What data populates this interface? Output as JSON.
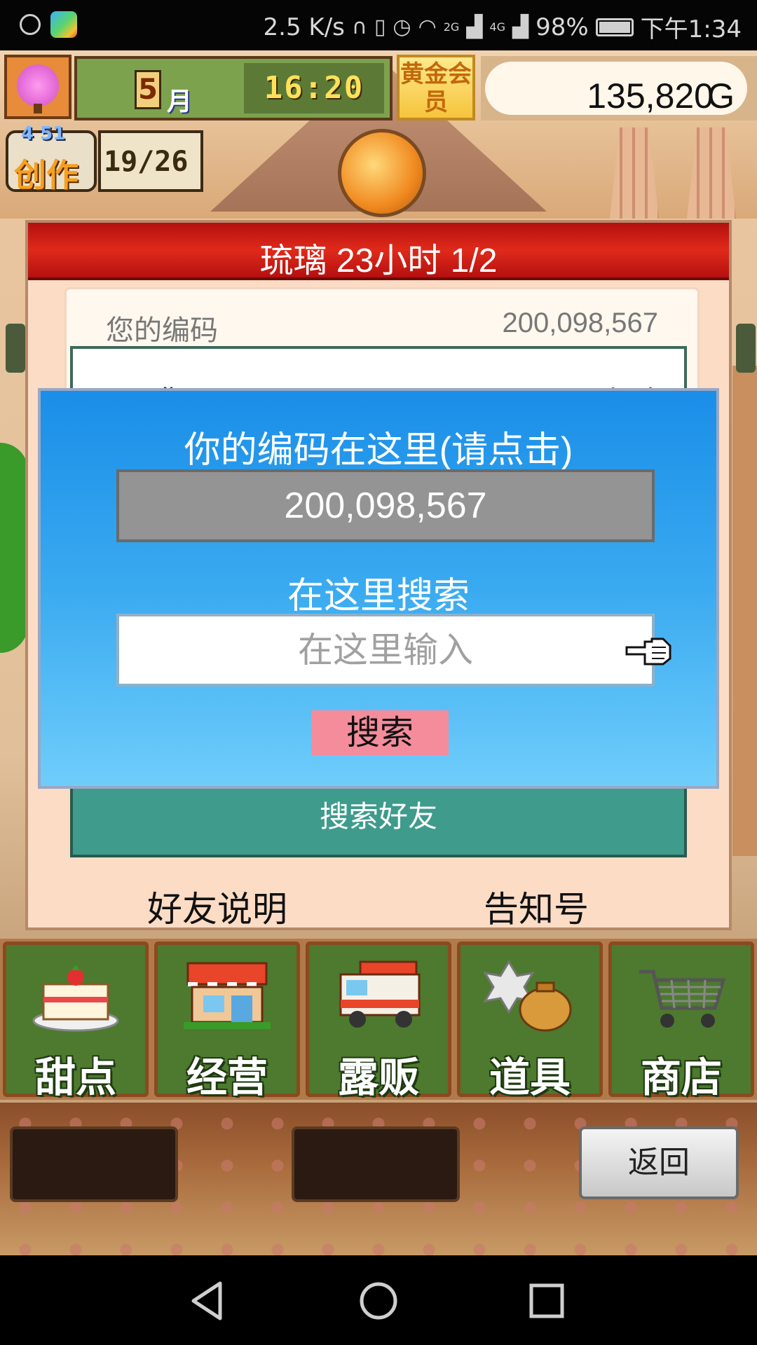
{
  "status_bar": {
    "network_speed": "2.5 K/s",
    "signal_1": "2G",
    "signal_2": "4G",
    "battery": "98%",
    "time": "下午1:34"
  },
  "hud": {
    "month_number": "5",
    "month_unit": "月",
    "clock": "16:20",
    "member_badge": "黄金会员",
    "gold_amount": "135,820",
    "gold_unit": "G",
    "create_label": "创作",
    "create_level": "4 51",
    "create_progress": "19/26"
  },
  "window": {
    "title": "琉璃  23小时 1/2",
    "code_label": "您的编码",
    "code_value": "200,098,567",
    "list_peek_left": "野面集",
    "list_peek_right": "已上时",
    "search_friends_label": "搜索好友",
    "link_friend_help": "好友说明",
    "link_notice_number": "告知号"
  },
  "modal": {
    "title": "你的编码在这里(请点击)",
    "code_value": "200,098,567",
    "search_title": "在这里搜索",
    "search_placeholder": "在这里输入",
    "search_button": "搜索"
  },
  "menu": {
    "items": [
      {
        "label": "甜点",
        "icon": "cake-icon"
      },
      {
        "label": "经营",
        "icon": "shop-building-icon"
      },
      {
        "label": "露贩",
        "icon": "food-truck-icon"
      },
      {
        "label": "道具",
        "icon": "items-bag-icon"
      },
      {
        "label": "商店",
        "icon": "shopping-cart-icon"
      }
    ]
  },
  "bottom": {
    "back_button": "返回"
  },
  "colors": {
    "title_red": "#d41c14",
    "modal_blue": "#2a9cec",
    "search_pink": "#f48c9c",
    "menu_green": "#4d7a2e"
  }
}
